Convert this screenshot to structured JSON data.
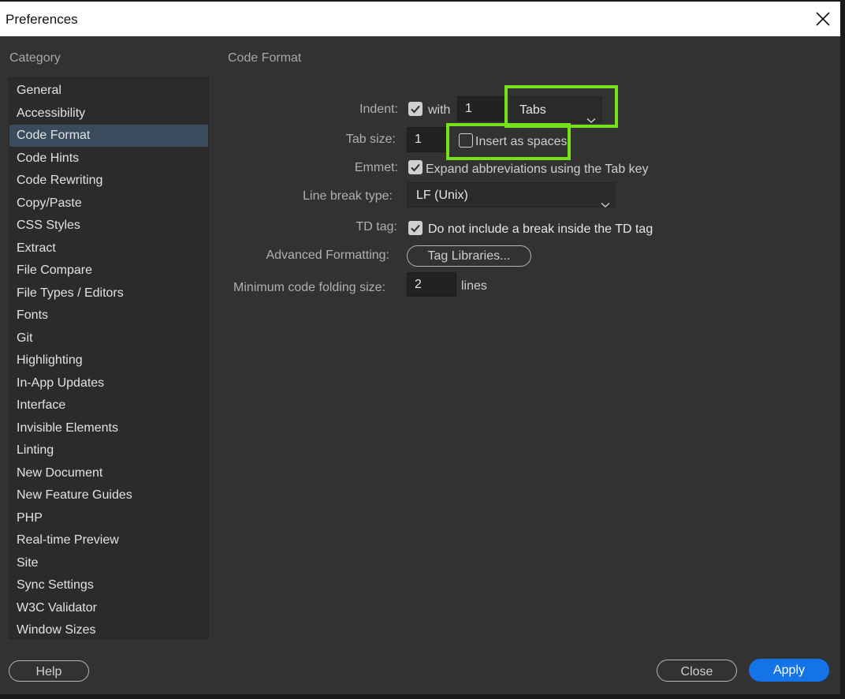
{
  "window": {
    "title": "Preferences"
  },
  "sidebar": {
    "header": "Category",
    "selected_index": 2,
    "items": [
      {
        "label": "General"
      },
      {
        "label": "Accessibility"
      },
      {
        "label": "Code Format"
      },
      {
        "label": "Code Hints"
      },
      {
        "label": "Code Rewriting"
      },
      {
        "label": "Copy/Paste"
      },
      {
        "label": "CSS Styles"
      },
      {
        "label": "Extract"
      },
      {
        "label": "File Compare"
      },
      {
        "label": "File Types / Editors"
      },
      {
        "label": "Fonts"
      },
      {
        "label": "Git"
      },
      {
        "label": "Highlighting"
      },
      {
        "label": "In-App Updates"
      },
      {
        "label": "Interface"
      },
      {
        "label": "Invisible Elements"
      },
      {
        "label": "Linting"
      },
      {
        "label": "New Document"
      },
      {
        "label": "New Feature Guides"
      },
      {
        "label": "PHP"
      },
      {
        "label": "Real-time Preview"
      },
      {
        "label": "Site"
      },
      {
        "label": "Sync Settings"
      },
      {
        "label": "W3C Validator"
      },
      {
        "label": "Window Sizes"
      }
    ]
  },
  "main": {
    "section_title": "Code Format",
    "indent": {
      "label": "Indent:",
      "checked": true,
      "with_label": "with",
      "value": "1",
      "unit": "Tabs"
    },
    "tab_size": {
      "label": "Tab size:",
      "value": "1",
      "insert_spaces_label": "Insert as spaces",
      "insert_spaces_checked": false
    },
    "emmet": {
      "label": "Emmet:",
      "checked": true,
      "text": "Expand abbreviations using the Tab key"
    },
    "line_break": {
      "label": "Line break type:",
      "value": "LF (Unix)"
    },
    "td_tag": {
      "label": "TD tag:",
      "checked": true,
      "text": "Do not include a break inside the TD tag"
    },
    "advanced": {
      "label": "Advanced Formatting:",
      "button": "Tag Libraries..."
    },
    "folding": {
      "label": "Minimum code folding size:",
      "value": "2",
      "unit": "lines"
    }
  },
  "footer": {
    "help": "Help",
    "close": "Close",
    "apply": "Apply"
  },
  "colors": {
    "highlight": "#76e01a",
    "accent": "#1473e6",
    "selection": "#3a4b5d"
  }
}
